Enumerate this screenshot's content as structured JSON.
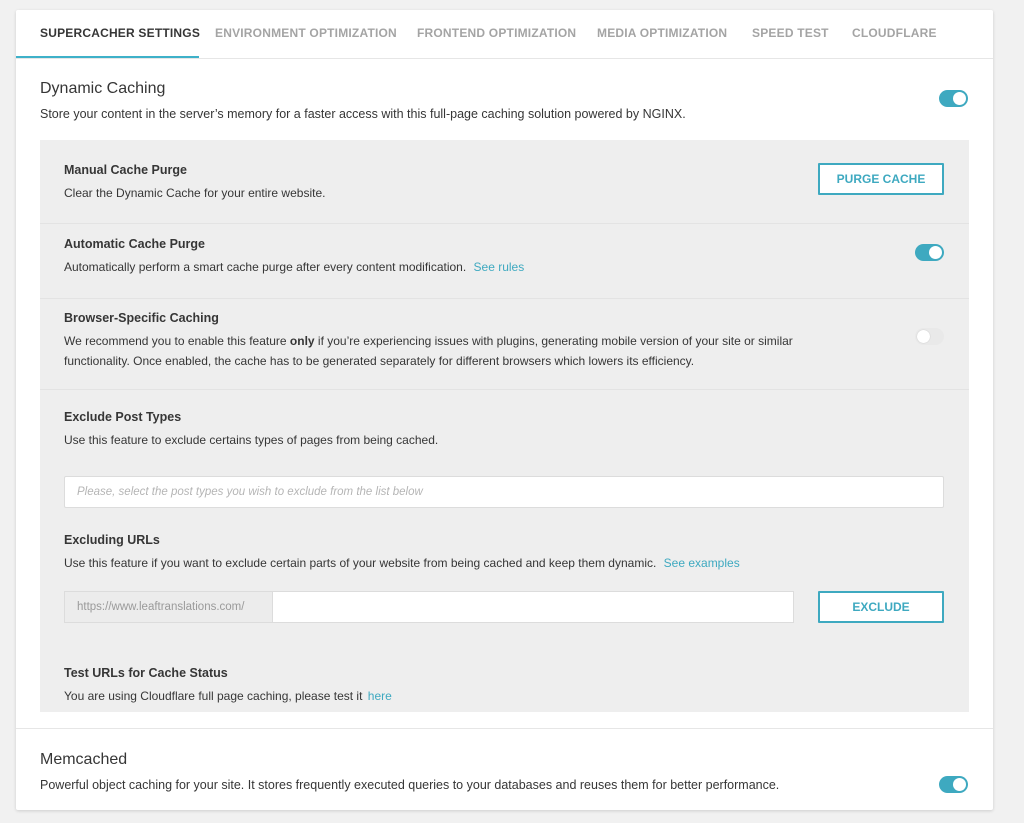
{
  "tabs": [
    {
      "label": "SUPERCACHER SETTINGS",
      "active": true
    },
    {
      "label": "ENVIRONMENT OPTIMIZATION",
      "active": false
    },
    {
      "label": "FRONTEND OPTIMIZATION",
      "active": false
    },
    {
      "label": "MEDIA OPTIMIZATION",
      "active": false
    },
    {
      "label": "SPEED TEST",
      "active": false
    },
    {
      "label": "CLOUDFLARE",
      "active": false
    }
  ],
  "colors": {
    "accent": "#3ea9c0",
    "panel": "#eeeeee",
    "text": "#363636"
  },
  "dynamic_caching": {
    "title": "Dynamic Caching",
    "description": "Store your content in the server’s memory for a faster access with this full-page caching solution powered by NGINX.",
    "enabled": true
  },
  "manual_purge": {
    "title": "Manual Cache Purge",
    "description": "Clear the Dynamic Cache for your entire website.",
    "button_label": "PURGE CACHE"
  },
  "auto_purge": {
    "title": "Automatic Cache Purge",
    "description": "Automatically perform a smart cache purge after every content modification.",
    "link_label": "See rules",
    "enabled": true
  },
  "browser_caching": {
    "title": "Browser-Specific Caching",
    "desc_before": "We recommend you to enable this feature ",
    "desc_bold": "only",
    "desc_after": " if you’re experiencing issues with plugins, generating mobile version of your site or similar functionality. Once enabled, the cache has to be generated separately for different browsers which lowers its efficiency.",
    "enabled": false
  },
  "exclude_post_types": {
    "title": "Exclude Post Types",
    "description": "Use this feature to exclude certains types of pages from being cached.",
    "placeholder": "Please, select the post types you wish to exclude from the list below"
  },
  "excluding_urls": {
    "title": "Excluding URLs",
    "description": "Use this feature if you want to exclude certain parts of your website from being cached and keep them dynamic.",
    "link_label": "See examples",
    "url_prefix": "https://www.leaftranslations.com/",
    "input_value": "",
    "button_label": "EXCLUDE"
  },
  "test_urls": {
    "title": "Test URLs for Cache Status",
    "description": "You are using Cloudflare full page caching, please test it",
    "link_label": "here"
  },
  "memcached": {
    "title": "Memcached",
    "description": "Powerful object caching for your site. It stores frequently executed queries to your databases and reuses them for better performance.",
    "enabled": true
  }
}
